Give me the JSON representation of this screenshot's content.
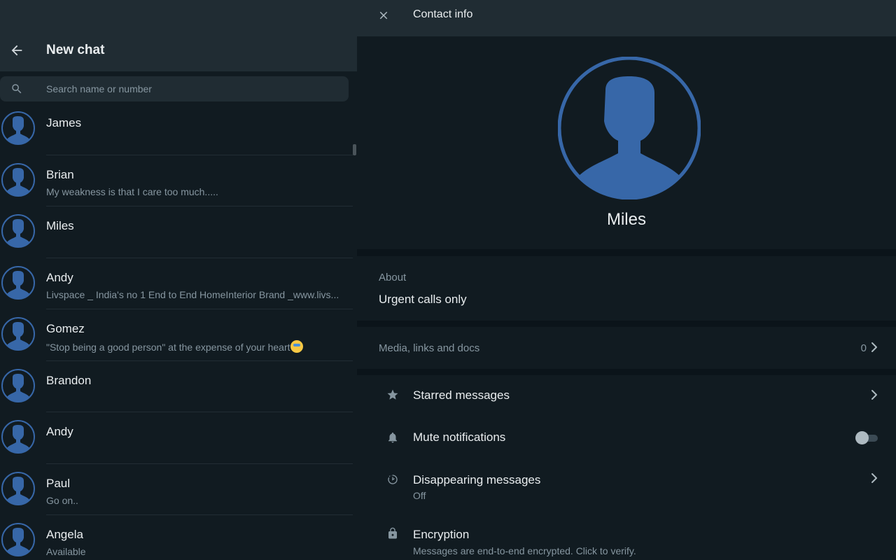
{
  "left_panel": {
    "title": "New chat",
    "search": {
      "placeholder": "Search name or number",
      "value": ""
    },
    "contacts": [
      {
        "name": "James",
        "status": ""
      },
      {
        "name": "Brian",
        "status": "My weakness is that I care too much....."
      },
      {
        "name": "Miles",
        "status": ""
      },
      {
        "name": "Andy",
        "status": "Livspace _ India's no 1 End to End HomeInterior Brand _www.livs..."
      },
      {
        "name": "Gomez",
        "status": "\"Stop being a good person\" at the expense of your heart"
      },
      {
        "name": "Brandon",
        "status": ""
      },
      {
        "name": "Andy",
        "status": ""
      },
      {
        "name": "Paul",
        "status": "Go on.."
      },
      {
        "name": "Angela",
        "status": "Available"
      }
    ]
  },
  "right_panel": {
    "title": "Contact info",
    "profile": {
      "name": "Miles"
    },
    "about": {
      "label": "About",
      "text": "Urgent calls only"
    },
    "media": {
      "label": "Media, links and docs",
      "count": "0"
    },
    "options": {
      "starred": {
        "label": "Starred messages",
        "icon": "star-icon"
      },
      "mute": {
        "label": "Mute notifications",
        "icon": "bell-icon",
        "enabled": false
      },
      "disappearing": {
        "label": "Disappearing messages",
        "sub": "Off",
        "icon": "timer-icon"
      },
      "encryption": {
        "label": "Encryption",
        "sub": "Messages are end-to-end encrypted. Click to verify.",
        "icon": "lock-icon"
      }
    }
  },
  "colors": {
    "background": "#111b21",
    "header": "#202c33",
    "avatar_blue": "#3767a8",
    "text_primary": "#e9edef",
    "text_secondary": "#8696a0"
  }
}
